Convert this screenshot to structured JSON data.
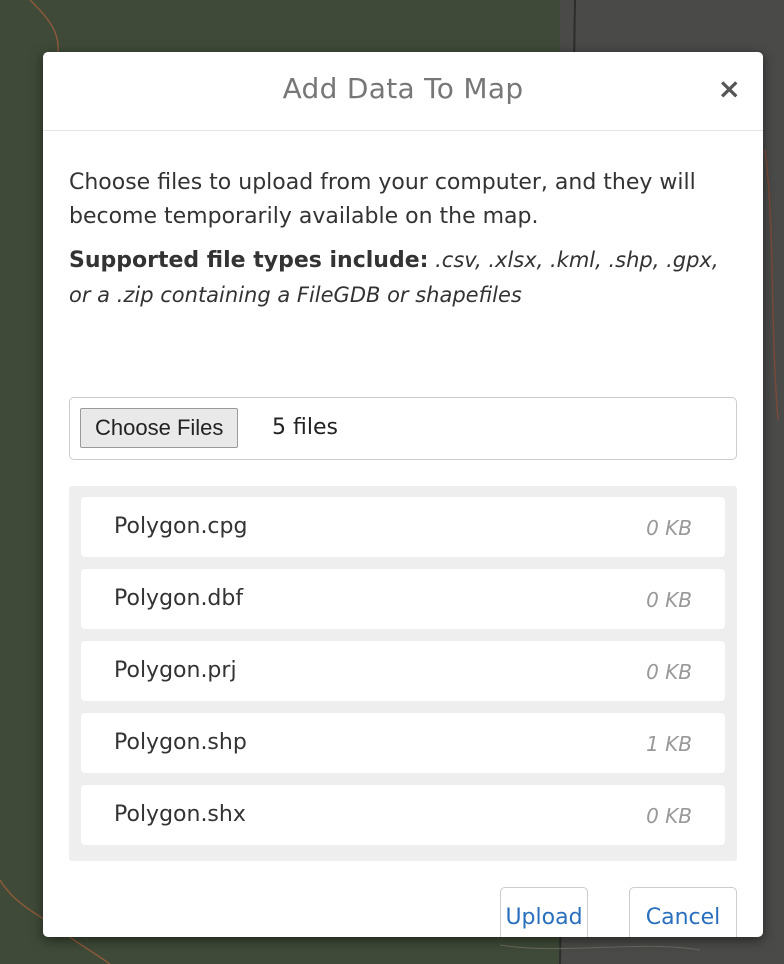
{
  "dialog": {
    "title": "Add Data To Map",
    "close_symbol": "×"
  },
  "body": {
    "intro": "Choose files to upload from your computer, and they will become temporarily available on the map.",
    "types_label": "Supported file types include:",
    "types_extensions": ".csv, .xlsx, .kml, .shp, .gpx, or a .zip containing a FileGDB or shapefiles"
  },
  "file_input": {
    "button_label": "Choose Files",
    "status": "5 files"
  },
  "files": [
    {
      "name": "Polygon.cpg",
      "size": "0 KB"
    },
    {
      "name": "Polygon.dbf",
      "size": "0 KB"
    },
    {
      "name": "Polygon.prj",
      "size": "0 KB"
    },
    {
      "name": "Polygon.shp",
      "size": "1 KB"
    },
    {
      "name": "Polygon.shx",
      "size": "0 KB"
    }
  ],
  "actions": {
    "upload_label": "Upload",
    "cancel_label": "Cancel"
  },
  "colors": {
    "backdrop": "#454a44",
    "link_blue": "#2a6fbd",
    "list_background": "#eeeeee"
  },
  "icons": {
    "close": "close-icon"
  }
}
